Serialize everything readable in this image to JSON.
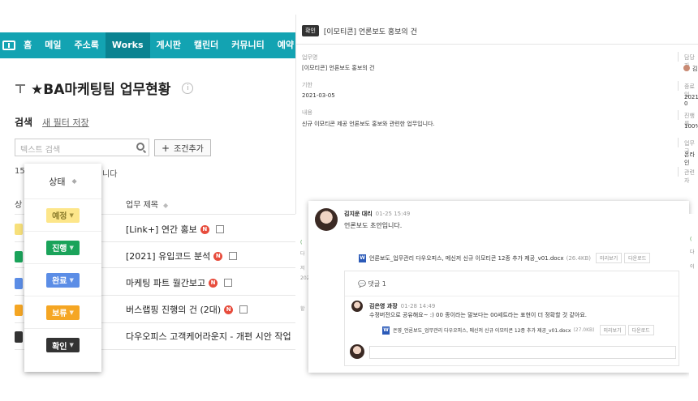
{
  "nav": {
    "items": [
      "홈",
      "메일",
      "주소록",
      "Works",
      "게시판",
      "캘린더",
      "커뮤니티",
      "예약"
    ]
  },
  "page": {
    "title": "★BA마케팅팀 업무현황",
    "info_icon": "i",
    "search_label": "검색",
    "filter_link": "새 필터 저장",
    "search_placeholder": "텍스트 검색",
    "add_condition": "조건추가",
    "count_prefix": "15",
    "count_suffix": "니다",
    "col_status": "상",
    "col_title": "업무 제목",
    "rows": [
      {
        "title": "[Link+] 연간 홍보",
        "new": "N",
        "color": "#f7e07a"
      },
      {
        "title": "[2021] 유입코드 분석",
        "new": "N",
        "color": "#1aa35a"
      },
      {
        "title": "마케팅 파트 월간보고",
        "new": "N",
        "color": "#5b8de6"
      },
      {
        "title": "버스랩핑 진행의 건 (2대)",
        "new": "N",
        "color": "#f5a623"
      },
      {
        "title": "다우오피스 고객케어라운지 - 개편 시안 작업",
        "new": "",
        "color": "#333333"
      }
    ]
  },
  "status_popup": {
    "header": "상태",
    "options": [
      {
        "label": "예정",
        "bg": "#fde68a",
        "fg": "#8a7a2a"
      },
      {
        "label": "진행",
        "bg": "#1aa35a",
        "fg": "#ffffff"
      },
      {
        "label": "완료",
        "bg": "#5b8de6",
        "fg": "#ffffff"
      },
      {
        "label": "보류",
        "bg": "#f5a623",
        "fg": "#ffffff"
      },
      {
        "label": "확인",
        "bg": "#333333",
        "fg": "#ffffff"
      }
    ]
  },
  "detail": {
    "tag": "확인",
    "title": "[이모티콘] 언론보도 홍보의 건",
    "fields": [
      {
        "label": "업무명",
        "value": "[이모티콘] 언론보도 홍보의 건"
      },
      {
        "label": "기한",
        "value": "2021-03-05"
      },
      {
        "label": "내용",
        "value": "신규 이모티콘 제공 언론보도 홍보와 관련한 업무입니다."
      }
    ],
    "side_labels": [
      "담당자",
      "종료일",
      "진행률",
      "업무 구",
      "관련자"
    ],
    "side_values": [
      "김",
      "2021-0",
      "100%",
      "온라인"
    ]
  },
  "strip": {
    "texts": [
      "(",
      "다",
      "저",
      "202",
      "할"
    ]
  },
  "comment": {
    "author": "김지운 대리",
    "time": "01-25 15:49",
    "text": "언론보도 초안입니다.",
    "file_name": "언론보도_업무관리 다우오피스, 메신저 신규 이모티콘 12종 추가 제공_v01.docx",
    "file_size": "(26.4KB)",
    "btn_preview": "미리보기",
    "btn_download": "다운로드",
    "reply_count": "댓글 1",
    "reply": {
      "author": "김은영 과장",
      "time": "01-28 14:49",
      "text": "수정버전으로 공유해요~ :) 00 종이라는 말보다는 00세트라는 표현이 더 정확할 것 같아요.",
      "file_name": "은영_언론보도_업무관리 다우오피스, 메신저 신규 이모티콘 12종 추가 제공_v01.docx",
      "file_size": "(27.0KB)",
      "btn_preview": "미리보기",
      "btn_download": "다운로드"
    }
  },
  "right_edge": {
    "texts": [
      "(",
      "다",
      "이"
    ]
  }
}
